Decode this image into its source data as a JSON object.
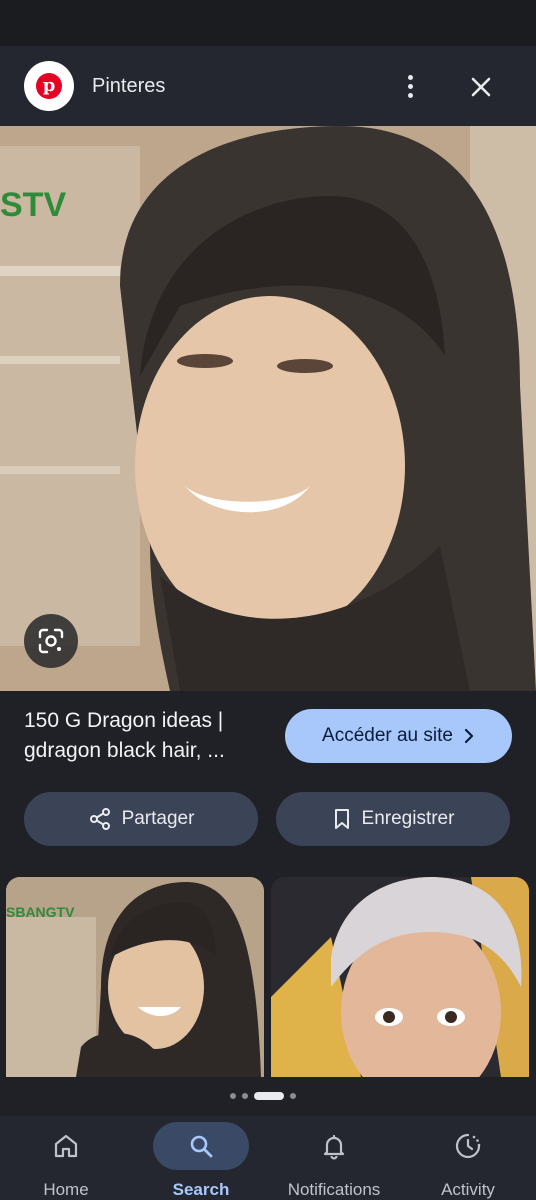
{
  "header": {
    "site_name": "Pinteres",
    "logo_letter": "p"
  },
  "result": {
    "title_line1": "150 G Dragon ideas |",
    "title_line2": "gdragon black hair, ...",
    "visit_label": "Accéder au site",
    "share_label": "Partager",
    "save_label": "Enregistrer"
  },
  "image_watermarks": {
    "hero": "STV",
    "thumb1": "SBANGTV"
  },
  "nav": {
    "home": "Home",
    "search": "Search",
    "notifications": "Notifications",
    "activity": "Activity"
  },
  "colors": {
    "accent": "#a8c7fa",
    "pinterest_red": "#e60023",
    "background": "#1f2127"
  }
}
